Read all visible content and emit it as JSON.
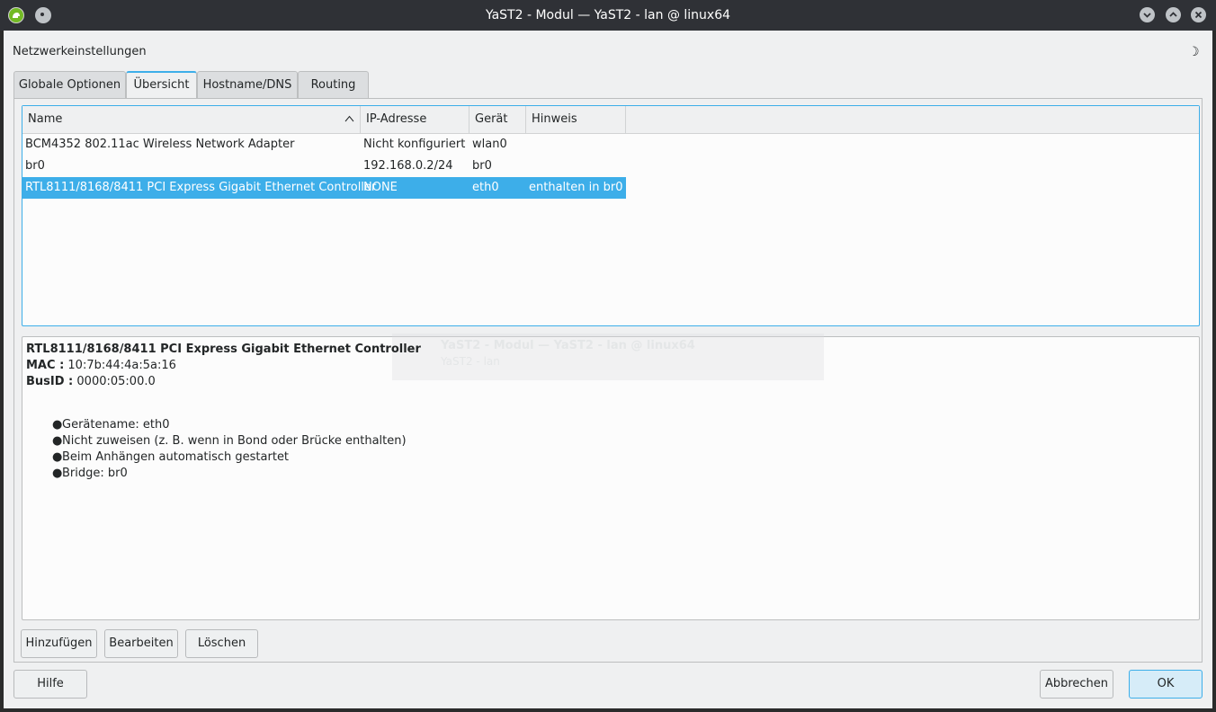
{
  "window": {
    "title": "YaST2 - Modul — YaST2 - lan @ linux64"
  },
  "header": {
    "heading": "Netzwerkeinstellungen",
    "theme_icon": "moon-icon"
  },
  "tabs": [
    {
      "label": "Globale Optionen"
    },
    {
      "label": "Übersicht",
      "active": true
    },
    {
      "label": "Hostname/DNS"
    },
    {
      "label": "Routing"
    }
  ],
  "table": {
    "columns": [
      "Name",
      "IP-Adresse",
      "Gerät",
      "Hinweis"
    ],
    "rows": [
      {
        "name": "BCM4352 802.11ac Wireless Network Adapter",
        "ip": "Nicht konfiguriert",
        "device": "wlan0",
        "note": ""
      },
      {
        "name": "br0",
        "ip": "192.168.0.2/24",
        "device": "br0",
        "note": ""
      },
      {
        "name": "RTL8111/8168/8411 PCI Express Gigabit Ethernet Controller",
        "ip": "NONE",
        "device": "eth0",
        "note": "enthalten in br0",
        "selected": true
      }
    ]
  },
  "details": {
    "title": "RTL8111/8168/8411 PCI Express Gigabit Ethernet Controller",
    "mac_label": "MAC :",
    "mac_value": "10:7b:44:4a:5a:16",
    "busid_label": "BusID :",
    "busid_value": "0000:05:00.0",
    "items": [
      "Gerätename: eth0",
      "Nicht zuweisen (z. B. wenn in Bond oder Brücke enthalten)",
      "Beim Anhängen automatisch gestartet",
      "Bridge: br0"
    ],
    "ghost_line1": "YaST2 - Modul — YaST2 - lan @ linux64",
    "ghost_line2": "YaST2 - lan"
  },
  "buttons": {
    "add": "Hinzufügen",
    "edit": "Bearbeiten",
    "delete": "Löschen",
    "help": "Hilfe",
    "cancel": "Abbrechen",
    "ok": "OK"
  },
  "colors": {
    "accent": "#3daee9",
    "titlebar": "#2f3136",
    "window_bg": "#eff0f1"
  }
}
